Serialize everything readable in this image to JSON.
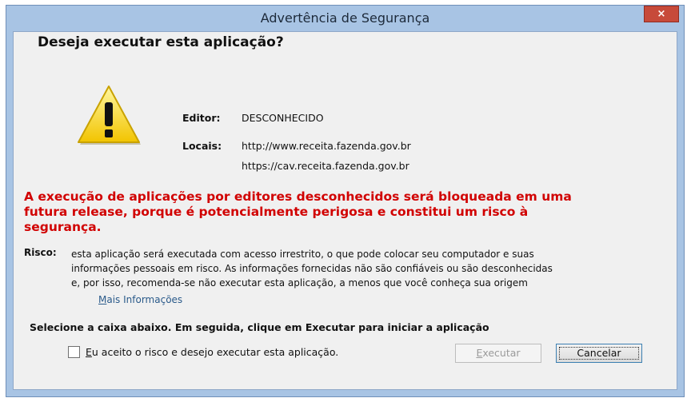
{
  "window": {
    "title": "Advertência de Segurança",
    "close_label": "×"
  },
  "dialog": {
    "heading": "Deseja executar esta aplicação?",
    "editor_label": "Editor:",
    "editor_value": "DESCONHECIDO",
    "locais_label": "Locais:",
    "locais_values": [
      "http://www.receita.fazenda.gov.br",
      "https://cav.receita.fazenda.gov.br"
    ],
    "warning_lines": [
      "A execução de aplicações por editores desconhecidos será bloqueada em uma",
      "futura release, porque é potencialmente perigosa e constitui um risco à",
      "segurança."
    ],
    "risk_label": "Risco:",
    "risk_lines": [
      "esta aplicação será executada com acesso irrestrito, o que pode colocar seu computador e suas",
      "informações pessoais em risco. As informações fornecidas não são confiáveis ou são desconhecidas",
      "e, por isso, recomenda-se não executar esta aplicação, a menos que você conheça sua origem"
    ],
    "more_info_first": "M",
    "more_info_rest": "ais Informações",
    "select_instruction": "Selecione a caixa abaixo. Em seguida, clique em Executar para iniciar a aplicação",
    "checkbox_first": "E",
    "checkbox_rest": "u aceito o risco e desejo executar esta aplicação.",
    "checkbox_checked": false,
    "run_first": "E",
    "run_rest": "xecutar",
    "cancel_label": "Cancelar"
  },
  "colors": {
    "warning_red": "#d10000",
    "title_bar": "#a8c4e4",
    "close_red": "#c74a3a"
  },
  "icons": {
    "warning": "warning-triangle-icon",
    "close": "close-icon"
  }
}
